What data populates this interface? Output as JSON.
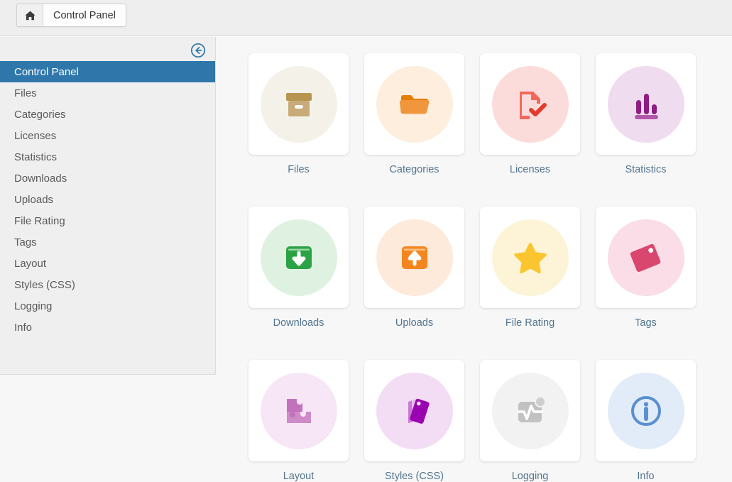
{
  "toolbar": {
    "home_icon": "home-icon",
    "breadcrumb_label": "Control Panel"
  },
  "sidebar": {
    "collapse_icon": "arrow-circle-left-icon",
    "items": [
      {
        "label": "Control Panel",
        "active": true
      },
      {
        "label": "Files",
        "active": false
      },
      {
        "label": "Categories",
        "active": false
      },
      {
        "label": "Licenses",
        "active": false
      },
      {
        "label": "Statistics",
        "active": false
      },
      {
        "label": "Downloads",
        "active": false
      },
      {
        "label": "Uploads",
        "active": false
      },
      {
        "label": "File Rating",
        "active": false
      },
      {
        "label": "Tags",
        "active": false
      },
      {
        "label": "Layout",
        "active": false
      },
      {
        "label": "Styles (CSS)",
        "active": false
      },
      {
        "label": "Logging",
        "active": false
      },
      {
        "label": "Info",
        "active": false
      }
    ]
  },
  "colors": {
    "active_nav": "#2f77ab",
    "tile_label": "#52748f",
    "page_background": "#f7f7f8",
    "toolbar_background": "#eeeeee",
    "sidebar_background": "#efefef"
  },
  "tiles": [
    {
      "label": "Files",
      "icon": "archive-box-icon",
      "circle": "#f4f1e9",
      "color": "#c9ab79",
      "accent": "#b8954f"
    },
    {
      "label": "Categories",
      "icon": "folder-icon",
      "circle": "#fdeedd",
      "color": "#f0963c",
      "accent": "#e57f00"
    },
    {
      "label": "Licenses",
      "icon": "document-check-icon",
      "circle": "#fcdcda",
      "color": "#f2675c",
      "accent": "#e23b2e"
    },
    {
      "label": "Statistics",
      "icon": "bar-chart-icon",
      "circle": "#f0dcef",
      "color": "#8e1d82",
      "accent": "#b259ab"
    },
    {
      "label": "Downloads",
      "icon": "download-box-icon",
      "circle": "#dff2e2",
      "color": "#2ba244",
      "accent": "#ffffff"
    },
    {
      "label": "Uploads",
      "icon": "upload-box-icon",
      "circle": "#fdeadb",
      "color": "#f5861f",
      "accent": "#ffffff"
    },
    {
      "label": "File Rating",
      "icon": "star-icon",
      "circle": "#fdf4d8",
      "color": "#fbc530",
      "accent": "#fbc530"
    },
    {
      "label": "Tags",
      "icon": "tags-icon",
      "circle": "#fadde6",
      "color": "#d9476e",
      "accent": "#ffffff"
    },
    {
      "label": "Layout",
      "icon": "puzzle-piece-icon",
      "circle": "#f7e7f6",
      "color": "#cf8ac8",
      "accent": "#c272bb"
    },
    {
      "label": "Styles (CSS)",
      "icon": "color-swatches-icon",
      "circle": "#f2ddf4",
      "color": "#9a03b0",
      "accent": "#c97ad6"
    },
    {
      "label": "Logging",
      "icon": "activity-monitor-icon",
      "circle": "#f2f2f2",
      "color": "#c2c2c2",
      "accent": "#ffffff"
    },
    {
      "label": "Info",
      "icon": "info-circle-icon",
      "circle": "#e2ecf9",
      "color": "#5a8fd0",
      "accent": "#5a8fd0"
    }
  ]
}
